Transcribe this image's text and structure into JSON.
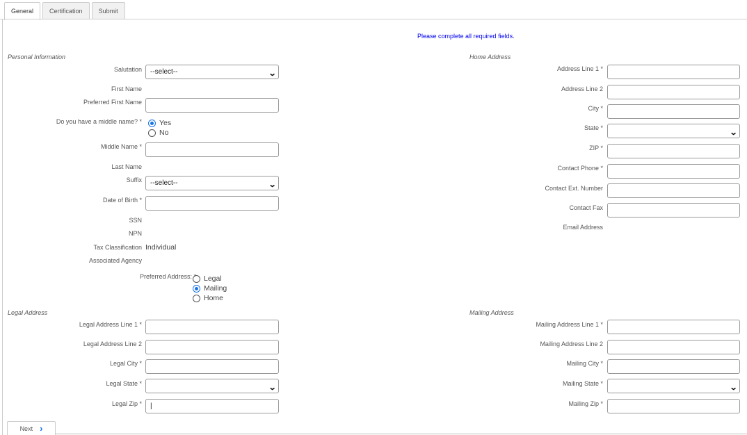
{
  "tabs": [
    {
      "label": "General",
      "active": true
    },
    {
      "label": "Certification",
      "active": false
    },
    {
      "label": "Submit",
      "active": false
    }
  ],
  "notice": "Please complete all required fields.",
  "personal": {
    "section_title": "Personal Information",
    "salutation_label": "Salutation",
    "salutation_value": "--select--",
    "first_name_label": "First Name",
    "preferred_first_name_label": "Preferred First Name",
    "preferred_first_name_value": "",
    "middle_name_question_label": "Do you have a middle name? *",
    "middle_name_options": [
      {
        "label": "Yes",
        "checked": true
      },
      {
        "label": "No",
        "checked": false
      }
    ],
    "middle_name_label": "Middle Name *",
    "middle_name_value": "",
    "last_name_label": "Last Name",
    "suffix_label": "Suffix",
    "suffix_value": "--select--",
    "dob_label": "Date of Birth *",
    "dob_value": "",
    "ssn_label": "SSN",
    "npn_label": "NPN",
    "tax_classification_label": "Tax Classification",
    "tax_classification_value": "Individual",
    "associated_agency_label": "Associated Agency",
    "preferred_address_label": "Preferred Address: *",
    "preferred_address_options": [
      {
        "label": "Legal",
        "checked": false
      },
      {
        "label": "Mailing",
        "checked": true
      },
      {
        "label": "Home",
        "checked": false
      }
    ]
  },
  "home": {
    "section_title": "Home Address",
    "line1_label": "Address Line 1 *",
    "line2_label": "Address Line 2",
    "city_label": "City *",
    "state_label": "State *",
    "state_value": "",
    "zip_label": "ZIP *",
    "phone_label": "Contact Phone *",
    "ext_label": "Contact Ext. Number",
    "fax_label": "Contact Fax",
    "email_label": "Email Address"
  },
  "legal": {
    "section_title": "Legal Address",
    "line1_label": "Legal Address Line 1 *",
    "line2_label": "Legal Address Line 2",
    "city_label": "Legal City *",
    "state_label": "Legal State *",
    "state_value": "",
    "zip_label": "Legal Zip *",
    "zip_value": "|"
  },
  "mailing": {
    "section_title": "Mailing Address",
    "line1_label": "Mailing Address Line 1 *",
    "line2_label": "Mailing Address Line 2",
    "city_label": "Mailing City *",
    "state_label": "Mailing State *",
    "state_value": "",
    "zip_label": "Mailing Zip *"
  },
  "footer": {
    "next_label": "Next"
  },
  "colors": {
    "accent": "#1a73e8",
    "notice": "#0000ee",
    "border": "#999999"
  }
}
